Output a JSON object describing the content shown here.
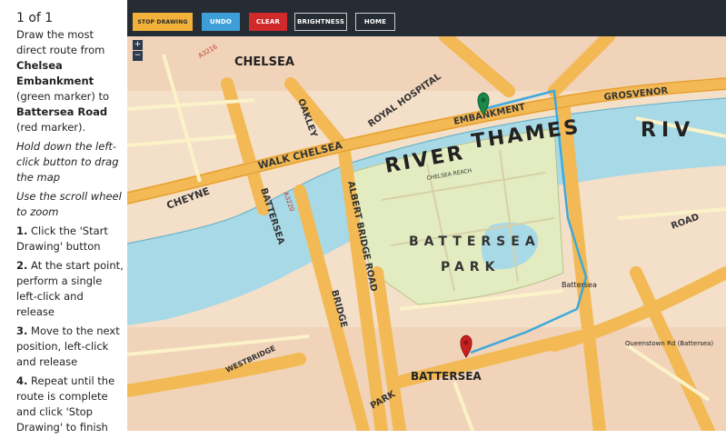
{
  "counter": "1  of 1",
  "instructions": {
    "intro_1": "Draw the most direct route from ",
    "origin": "Chelsea Embankment",
    "intro_2": " (green marker) to ",
    "destination": "Battersea Road",
    "intro_3": " (red marker).",
    "tip_drag": "Hold down the left-click button to drag the map",
    "tip_zoom": "Use the scroll wheel to zoom",
    "step1_num": "1.",
    "step1": " Click the 'Start Drawing' button",
    "step2_num": "2.",
    "step2": " At the start point, perform a single left-click and release",
    "step3_num": "3.",
    "step3": " Move to the next position, left-click and release",
    "step4_num": "4.",
    "step4": " Repeat until the route is complete and click 'Stop Drawing' to finish"
  },
  "toolbar": {
    "stop_drawing": "STOP DRAWING",
    "undo": "UNDO",
    "clear": "CLEAR",
    "brightness": "BRIGHTNESS",
    "home": "HOME"
  },
  "zoom": {
    "in": "+",
    "out": "−"
  },
  "map": {
    "chelsea": "CHELSEA",
    "river": "RIVER",
    "thames": "THAMES",
    "riv": "RIV",
    "battersea_park_1": "BATTERSEA",
    "battersea_park_2": "PARK",
    "battersea": "BATTERSEA",
    "battersea_station": "Battersea",
    "queenstown": "Queenstown Rd (Battersea)",
    "chelsea_reach": "CHELSEA REACH",
    "grosvenor": "GROSVENOR",
    "embankment": "EMBANKMENT",
    "chelsea_walk": "WALK   CHELSEA",
    "cheyne": "CHEYNE",
    "royal_hospital": "ROYAL HOSPITAL",
    "oakley": "OAKLEY",
    "battersea_bridge": "BATTERSEA",
    "albert_bridge": "ALBERT BRIDGE ROAD",
    "battersea_bridge_rd": "BRIDGE",
    "park_rd": "PARK",
    "westbridge": "WESTBRIDGE",
    "queenstown_road": "ROAD",
    "a3216": "A3216",
    "a3220": "A3220"
  },
  "colors": {
    "water": "#a8d9e6",
    "park": "#e3ecc0",
    "road": "#f2b954",
    "route": "#3ea8dc",
    "start_marker": "#1a8a4a",
    "end_marker": "#c8201e"
  }
}
